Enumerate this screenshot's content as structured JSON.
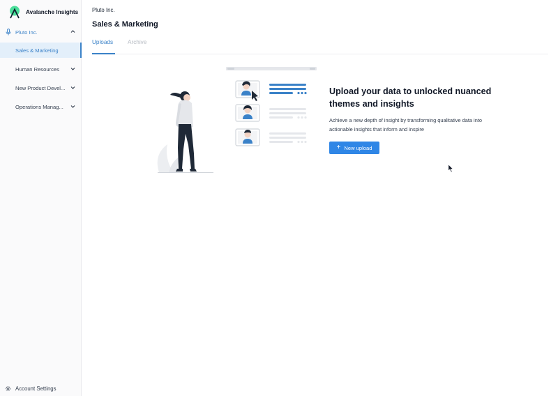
{
  "app": {
    "brand_name": "Avalanche Insights",
    "accent_color": "#3b82c8",
    "brand_logo_icon": "mountain-logo-icon"
  },
  "sidebar": {
    "org_label": "Pluto Inc.",
    "org_icon": "mic-icon",
    "items": [
      {
        "label": "Sales & Marketing",
        "active": true
      },
      {
        "label": "Human Resources",
        "active": false
      },
      {
        "label": "New Product Devel...",
        "active": false
      },
      {
        "label": "Operations Manag...",
        "active": false
      }
    ],
    "account_label": "Account Settings"
  },
  "header": {
    "breadcrumb": "Pluto Inc.",
    "title": "Sales & Marketing"
  },
  "tabs": [
    {
      "label": "Uploads",
      "active": true
    },
    {
      "label": "Archive",
      "active": false
    }
  ],
  "hero": {
    "title": "Upload your data to unlocked nuanced themes and insights",
    "description": "Achieve a new depth of insight by transforming qualitative data into actionable insights that inform and inspire",
    "button_label": "New upload",
    "button_icon": "plus-icon",
    "button_color": "#2f86e6"
  }
}
